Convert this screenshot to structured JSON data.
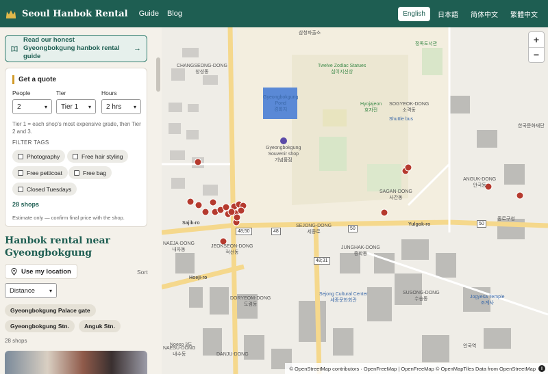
{
  "header": {
    "brand": "Seoul Hanbok Rental",
    "nav": [
      "Guide",
      "Blog"
    ],
    "languages": [
      "English",
      "日本語",
      "简体中文",
      "繁體中文"
    ],
    "active_language": "English"
  },
  "sidebar": {
    "guide_link": "Read our honest Gyeongbokgung hanbok rental guide",
    "guide_arrow": "→",
    "quote": {
      "title": "Get a quote",
      "people_label": "People",
      "tier_label": "Tier",
      "hours_label": "Hours",
      "people_value": "2",
      "tier_value": "Tier 1",
      "hours_value": "2 hrs",
      "note": "Tier 1 = each shop's most expensive grade, then Tier 2 and 3.",
      "filter_heading": "FILTER TAGS",
      "tags": [
        "Photography",
        "Free hair styling",
        "Free petticoat",
        "Free bag",
        "Closed Tuesdays"
      ],
      "count": "28 shops",
      "estimate_note": "Estimate only — confirm final price with the shop."
    },
    "section_title": "Hanbok rental near Gyeongbokgung",
    "my_location": "Use my location",
    "sort_label": "Sort",
    "sort_value": "Distance",
    "chips": [
      "Gyeongbokgung Palace gate",
      "Gyeongbokgung Stn.",
      "Anguk Stn."
    ],
    "shops_count": "28 shops"
  },
  "map": {
    "zoom_in": "+",
    "zoom_out": "−",
    "attribution": "© OpenStreetMap contributors · OpenFreeMap | OpenFreeMap © OpenMapTiles Data from OpenStreetMap",
    "info": "i",
    "labels": {
      "changseong": "CHANGSEONG-DONG\n창성동",
      "twelve": "Twelve Zodiac Statues\n십이지신상",
      "hyojaeon": "Hyojajeon\n효자전",
      "pond": "Gyeongbokgung\nPond\n경회지",
      "souvenir": "Gyeongbokgung\nSouvenir shop\n기념품점",
      "sogyeok": "SOGYEOK-DONG\n소격동",
      "shuttle": "Shuttle bus",
      "sagan": "SAGAN-DONG\n사간동",
      "sejong": "SEJONG-DONG\n세종로",
      "jeokseon": "JEOKSEON-DONG\n적선동",
      "naeja": "NAEJA-DONG\n내자동",
      "junghak": "JUNGHAK-DONG\n중학동",
      "doryeom": "DORYEOM-DONG\n도렴동",
      "sejongcenter": "Sejong Cultural Center\n세종문화회관",
      "jogye": "Jogyesa Temple\n조계사",
      "suseong": "SUSONG-DONG\n수송동",
      "anguk": "ANGUK-DONG\n안국동",
      "sajik": "Sajik-ro",
      "yulgok": "Yulgok-ro",
      "jeongdok": "정독도서관",
      "samcheong": "삼청파출소",
      "bukchon": "한국문화재단",
      "anguk2": "안국역",
      "jongno": "종로구청",
      "r1": "48;50",
      "r2": "48",
      "r3": "50",
      "r4": "48;31",
      "r5": "50",
      "hoe": "Hoeji-ro",
      "naesu": "NAESU-DONG\n내수동",
      "danju": "DANJU-DONG",
      "noeso": "Noeso 3도"
    }
  }
}
